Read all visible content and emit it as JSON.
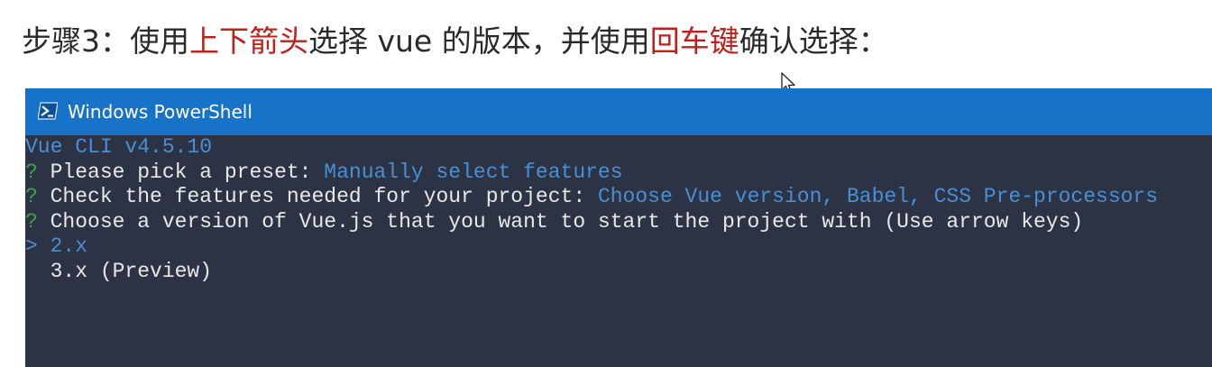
{
  "instruction": {
    "part1": "步骤3：使用",
    "highlight1": "上下箭头",
    "part2": "选择 vue 的版本，并使用",
    "highlight2": "回车键",
    "part3": "确认选择："
  },
  "window": {
    "title": "Windows PowerShell",
    "icon": "powershell-icon"
  },
  "terminal": {
    "version_line": "Vue CLI v4.5.10",
    "q1_mark": "?",
    "q1_text": "Please pick a preset: ",
    "q1_answer": "Manually select features",
    "q2_mark": "?",
    "q2_text": "Check the features needed for your project: ",
    "q2_answer": "Choose Vue version, Babel, CSS Pre-processors",
    "q3_mark": "?",
    "q3_text": "Choose a version of Vue.js that you want to start the project with (Use arrow keys)",
    "options": [
      {
        "pointer": ">",
        "label": "2.x",
        "selected": true
      },
      {
        "pointer": "",
        "label": "3.x (Preview)",
        "selected": false
      }
    ]
  },
  "colors": {
    "highlight": "#c0201c",
    "titlebar": "#1673c8",
    "terminal_bg": "#2b3345",
    "answer_blue": "#4a8fd4",
    "question_green": "#3fa34a"
  },
  "icons": {
    "cursor": "mouse-pointer-icon"
  }
}
